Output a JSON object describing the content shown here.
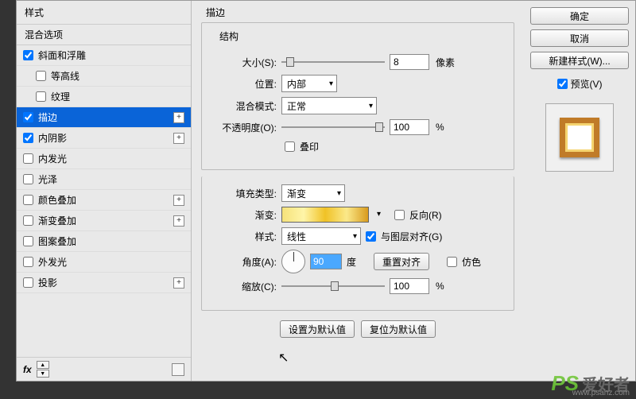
{
  "left": {
    "header": "样式",
    "blend": "混合选项",
    "items": [
      {
        "label": "斜面和浮雕",
        "checked": true,
        "plus": false
      },
      {
        "label": "等高线",
        "checked": false,
        "plus": false,
        "indent": true
      },
      {
        "label": "纹理",
        "checked": false,
        "plus": false,
        "indent": true
      },
      {
        "label": "描边",
        "checked": true,
        "plus": true,
        "selected": true
      },
      {
        "label": "内阴影",
        "checked": true,
        "plus": true
      },
      {
        "label": "内发光",
        "checked": false,
        "plus": false
      },
      {
        "label": "光泽",
        "checked": false,
        "plus": false
      },
      {
        "label": "颜色叠加",
        "checked": false,
        "plus": true
      },
      {
        "label": "渐变叠加",
        "checked": false,
        "plus": true
      },
      {
        "label": "图案叠加",
        "checked": false,
        "plus": false
      },
      {
        "label": "外发光",
        "checked": false,
        "plus": false
      },
      {
        "label": "投影",
        "checked": false,
        "plus": true
      }
    ],
    "fx": "fx"
  },
  "mid": {
    "title": "描边",
    "structure": {
      "legend": "结构",
      "size_label": "大小(S):",
      "size_val": "8",
      "size_unit": "像素",
      "pos_label": "位置:",
      "pos_val": "内部",
      "blend_label": "混合模式:",
      "blend_val": "正常",
      "opacity_label": "不透明度(O):",
      "opacity_val": "100",
      "opacity_unit": "%",
      "overprint": "叠印"
    },
    "fill": {
      "type_label": "填充类型:",
      "type_val": "渐变",
      "grad_label": "渐变:",
      "reverse": "反向(R)",
      "style_label": "样式:",
      "style_val": "线性",
      "align": "与图层对齐(G)",
      "angle_label": "角度(A):",
      "angle_val": "90",
      "angle_unit": "度",
      "reset_align": "重置对齐",
      "dither": "仿色",
      "scale_label": "缩放(C):",
      "scale_val": "100",
      "scale_unit": "%"
    },
    "defaults": {
      "set": "设置为默认值",
      "reset": "复位为默认值"
    }
  },
  "right": {
    "ok": "确定",
    "cancel": "取消",
    "newstyle": "新建样式(W)...",
    "preview": "预览(V)"
  },
  "watermark": {
    "ps": "PS",
    "cn": "爱好者",
    "url": "www.psahz.com"
  }
}
